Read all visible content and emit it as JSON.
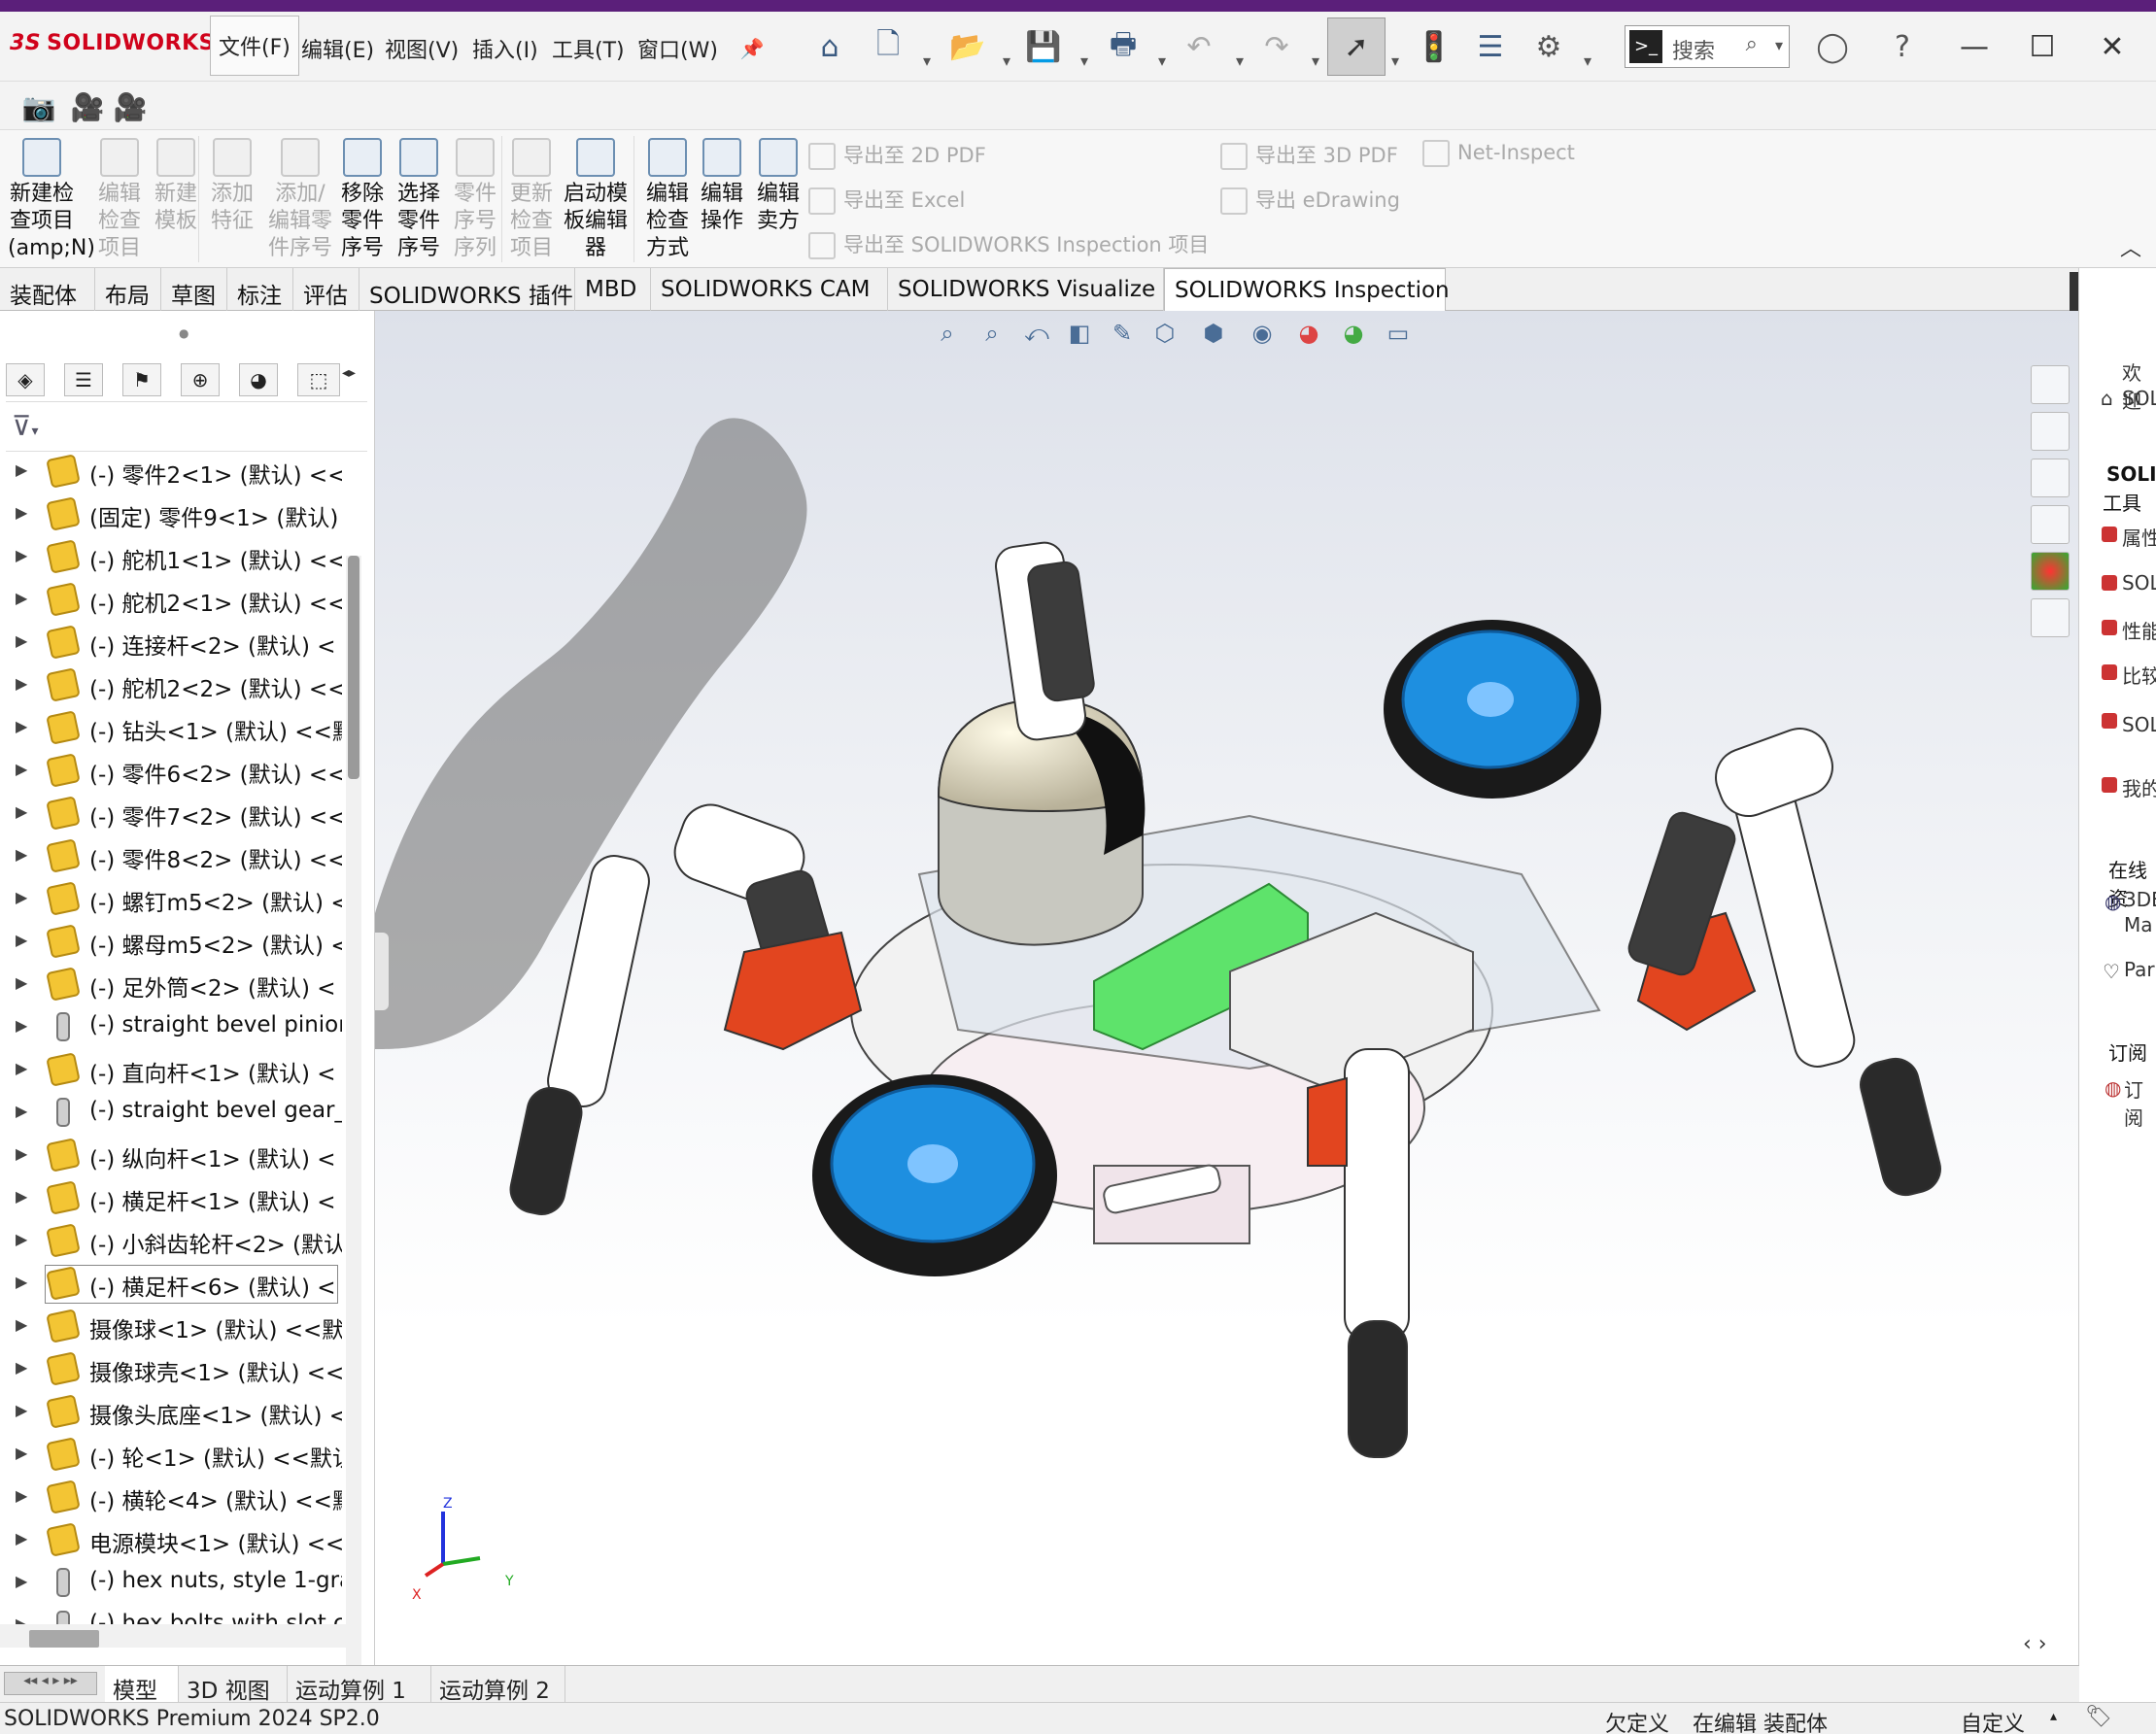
{
  "app": {
    "logo_mark": "3S",
    "logo_text": "SOLIDWORKS"
  },
  "menu": {
    "items": [
      "文件(F)",
      "编辑(E)",
      "视图(V)",
      "插入(I)",
      "工具(T)",
      "窗口(W)"
    ],
    "search_placeholder": "搜索"
  },
  "command_manager": {
    "buttons": [
      {
        "label": "新建检查项目(amp;N)",
        "lines": [
          "新建检",
          "查项目",
          "(amp;N)"
        ],
        "enabled": true
      },
      {
        "label": "编辑检查项目",
        "lines": [
          "编辑",
          "检查",
          "项目"
        ],
        "enabled": false
      },
      {
        "label": "新建模板",
        "lines": [
          "新建",
          "模板"
        ],
        "enabled": false
      },
      {
        "label": "添加特征",
        "lines": [
          "添加",
          "特征"
        ],
        "enabled": false
      },
      {
        "label": "添加/编辑零件序号",
        "lines": [
          "添加/",
          "编辑零",
          "件序号"
        ],
        "enabled": false
      },
      {
        "label": "移除零件序号",
        "lines": [
          "移除",
          "零件",
          "序号"
        ],
        "enabled": true
      },
      {
        "label": "选择零件序号",
        "lines": [
          "选择",
          "零件",
          "序号"
        ],
        "enabled": true
      },
      {
        "label": "零件序号序列",
        "lines": [
          "零件",
          "序号",
          "序列"
        ],
        "enabled": false
      },
      {
        "label": "更新检查项目",
        "lines": [
          "更新",
          "检查",
          "项目"
        ],
        "enabled": false
      },
      {
        "label": "启动模板编辑器",
        "lines": [
          "启动模",
          "板编辑",
          "器"
        ],
        "enabled": true
      },
      {
        "label": "编辑检查方式",
        "lines": [
          "编辑",
          "检查",
          "方式"
        ],
        "enabled": true
      },
      {
        "label": "编辑操作",
        "lines": [
          "编辑",
          "操作"
        ],
        "enabled": true
      },
      {
        "label": "编辑卖方",
        "lines": [
          "编辑",
          "卖方"
        ],
        "enabled": true
      }
    ],
    "exports_left": [
      "导出至 2D PDF",
      "导出至 Excel",
      "导出至 SOLIDWORKS Inspection 项目"
    ],
    "exports_right": [
      "导出至 3D PDF",
      "导出 eDrawing"
    ],
    "net_inspect": "Net-Inspect"
  },
  "tabs": [
    "装配体",
    "布局",
    "草图",
    "标注",
    "评估",
    "SOLIDWORKS 插件",
    "MBD",
    "SOLIDWORKS CAM",
    "SOLIDWORKS Visualize",
    "SOLIDWORKS Inspection"
  ],
  "active_tab": "SOLIDWORKS Inspection",
  "feature_tree": {
    "items": [
      {
        "text": "(-) 零件2<1> (默认) <<",
        "icon": "part-icon"
      },
      {
        "text": "(固定) 零件9<1> (默认)",
        "icon": "part-icon"
      },
      {
        "text": "(-) 舵机1<1> (默认) <<",
        "icon": "part-icon"
      },
      {
        "text": "(-) 舵机2<1> (默认) <<",
        "icon": "part-icon"
      },
      {
        "text": "(-) 连接杆<2> (默认) <",
        "icon": "part-icon"
      },
      {
        "text": "(-) 舵机2<2> (默认) <<",
        "icon": "part-icon"
      },
      {
        "text": "(-) 钻头<1> (默认) <<默",
        "icon": "part-icon"
      },
      {
        "text": "(-) 零件6<2> (默认) <<",
        "icon": "part-icon"
      },
      {
        "text": "(-) 零件7<2> (默认) <<",
        "icon": "part-icon"
      },
      {
        "text": "(-) 零件8<2> (默认) <<",
        "icon": "part-icon"
      },
      {
        "text": "(-) 螺钉m5<2> (默认) <",
        "icon": "part-icon"
      },
      {
        "text": "(-) 螺母m5<2> (默认) <",
        "icon": "part-icon"
      },
      {
        "text": "(-) 足外筒<2> (默认) <",
        "icon": "part-icon"
      },
      {
        "text": "(-) straight bevel pinion",
        "icon": "bolt-icon"
      },
      {
        "text": "(-) 直向杆<1> (默认) <",
        "icon": "part-icon"
      },
      {
        "text": "(-) straight bevel gear_",
        "icon": "bolt-icon"
      },
      {
        "text": "(-) 纵向杆<1> (默认) <",
        "icon": "part-icon"
      },
      {
        "text": "(-) 横足杆<1> (默认) <",
        "icon": "part-icon"
      },
      {
        "text": "(-) 小斜齿轮杆<2> (默认",
        "icon": "part-icon"
      },
      {
        "text": "(-) 横足杆<6> (默认) <",
        "icon": "part-icon"
      },
      {
        "text": "摄像球<1> (默认) <<默",
        "icon": "part-icon"
      },
      {
        "text": "摄像球壳<1> (默认) <<",
        "icon": "part-icon"
      },
      {
        "text": "摄像头底座<1> (默认) <",
        "icon": "part-icon"
      },
      {
        "text": "(-) 轮<1> (默认) <<默认",
        "icon": "part-icon"
      },
      {
        "text": "(-) 横轮<4> (默认) <<默",
        "icon": "part-icon"
      },
      {
        "text": "电源模块<1> (默认) <<",
        "icon": "part-icon"
      },
      {
        "text": "(-) hex nuts, style 1-gra",
        "icon": "bolt-icon"
      },
      {
        "text": "(-) hex bolts with slot c",
        "icon": "bolt-icon"
      }
    ],
    "selected_index": 19
  },
  "bottom_tabs": [
    "模型",
    "3D 视图",
    "运动算例 1",
    "运动算例 2"
  ],
  "active_bottom_tab": "模型",
  "status": {
    "product": "SOLIDWORKS Premium 2024 SP2.0",
    "definition": "欠定义",
    "mode": "在编辑 装配体",
    "units": "自定义"
  },
  "triad": {
    "x": "X",
    "y": "Y",
    "z": "Z"
  },
  "task_pane": {
    "welcome": [
      "欢迎",
      "SOL"
    ],
    "solid_heading": "SOLI",
    "tools": "工具",
    "links": [
      "属性",
      "SOL",
      "性能",
      "比较",
      "SOL置向",
      "我的"
    ],
    "online_heading": "在线资",
    "online_links": [
      "3DE",
      "Ma",
      "Par"
    ],
    "subscribe_heading": "订阅",
    "subscribe_link": "订阅"
  },
  "colors": {
    "title_accent": "#5b1f7a",
    "logo_red": "#d0021b",
    "wheel_blue": "#1e8fe0",
    "pcb_green": "#5ee36b",
    "servo_orange": "#e2451f",
    "part_yellow": "#f3c534"
  }
}
